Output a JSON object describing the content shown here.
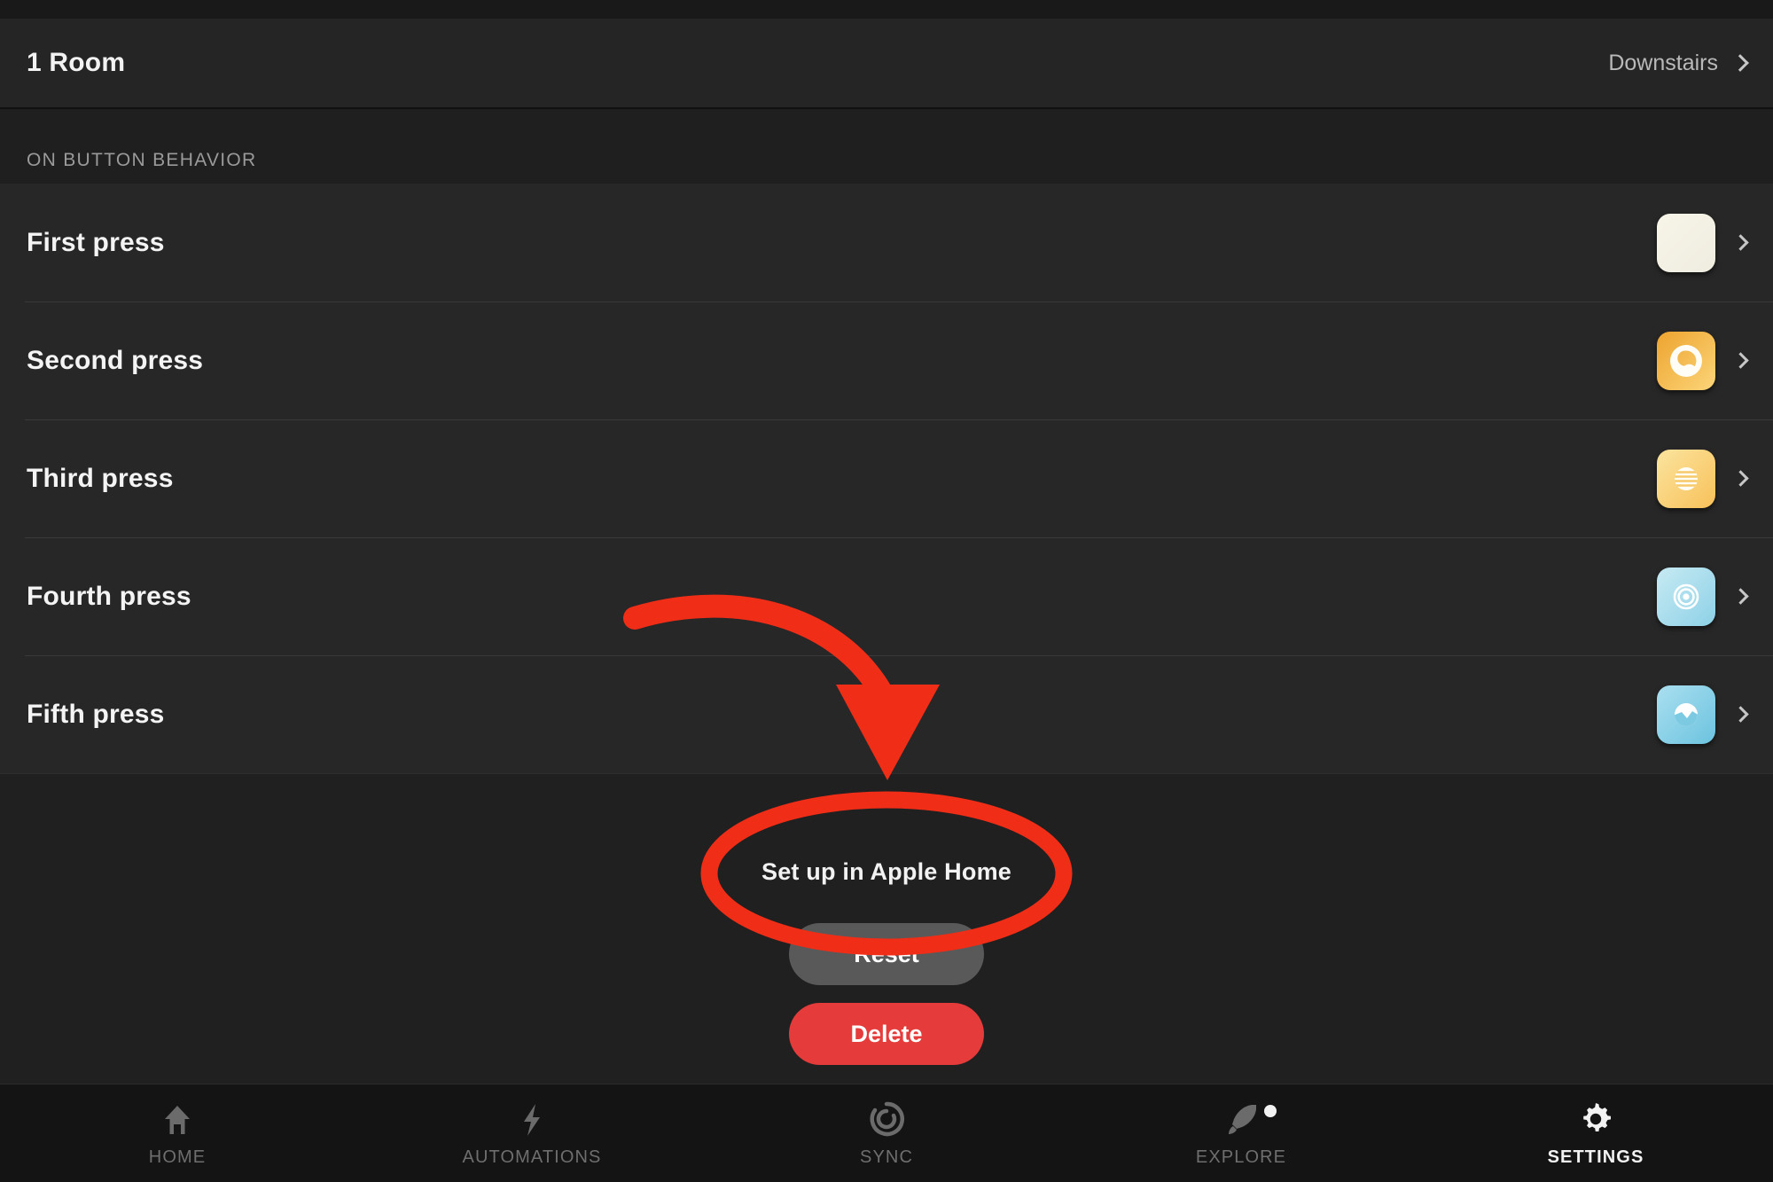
{
  "header": {
    "title": "1 Room",
    "room_label": "Downstairs",
    "chevron_icon": "chevron-right-icon"
  },
  "section": {
    "title": "ON BUTTON BEHAVIOR"
  },
  "rows": [
    {
      "label": "First press",
      "swatch": {
        "icon": "blank-scene-icon",
        "gradient_from": "#f7f4e8",
        "gradient_to": "#efece0"
      },
      "chevron_icon": "chevron-right-icon"
    },
    {
      "label": "Second press",
      "swatch": {
        "icon": "crescent-circle-scene-icon",
        "gradient_from": "#f0a93a",
        "gradient_to": "#fbd071"
      },
      "chevron_icon": "chevron-right-icon"
    },
    {
      "label": "Third press",
      "swatch": {
        "icon": "striped-circle-scene-icon",
        "gradient_from": "#fae198",
        "gradient_to": "#f8c45f"
      },
      "chevron_icon": "chevron-right-icon"
    },
    {
      "label": "Fourth press",
      "swatch": {
        "icon": "concentric-circles-scene-icon",
        "gradient_from": "#bfe8f2",
        "gradient_to": "#8fd2e8"
      },
      "chevron_icon": "chevron-right-icon"
    },
    {
      "label": "Fifth press",
      "swatch": {
        "icon": "wave-circle-scene-icon",
        "gradient_from": "#a5dcee",
        "gradient_to": "#6ec4e0"
      },
      "chevron_icon": "chevron-right-icon"
    }
  ],
  "footer": {
    "apple_home_link": "Set up in Apple Home",
    "reset_label": "Reset",
    "delete_label": "Delete",
    "reset_color": "#595959",
    "delete_color": "#e53b3b"
  },
  "tabbar": {
    "items": [
      {
        "label": "HOME",
        "icon": "home-icon",
        "active": false
      },
      {
        "label": "AUTOMATIONS",
        "icon": "lightning-bolt-icon",
        "active": false
      },
      {
        "label": "SYNC",
        "icon": "sync-icon",
        "active": false
      },
      {
        "label": "EXPLORE",
        "icon": "rocket-icon",
        "active": false,
        "badge": true
      },
      {
        "label": "SETTINGS",
        "icon": "gear-icon",
        "active": true
      }
    ]
  },
  "annotation": {
    "color": "#f02d17",
    "arrow": "curved-arrow-annotation",
    "ellipse": "ellipse-highlight-annotation"
  }
}
